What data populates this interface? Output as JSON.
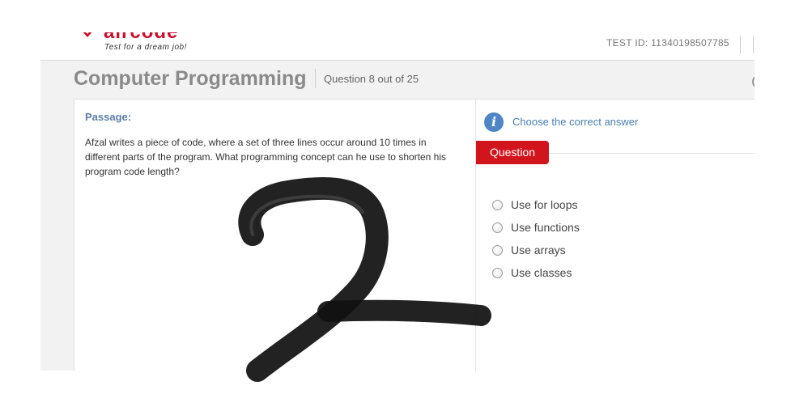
{
  "header": {
    "logo_text": "aircode",
    "tagline": "Test for a dream job!",
    "test_id": "TEST ID: 11340198507785"
  },
  "page": {
    "title": "Computer Programming",
    "question_counter": "Question 8 out of 25"
  },
  "passage": {
    "label": "Passage:",
    "text": "Afzal writes a piece of code, where a set of three lines occur around 10 times in different parts of the program. What programming concept can he use to shorten his program code length?"
  },
  "question_panel": {
    "instruction": "Choose the correct answer",
    "tab_label": "Question",
    "options": [
      "Use for loops",
      "Use functions",
      "Use arrays",
      "Use classes"
    ]
  },
  "colors": {
    "brand_red": "#d2151d",
    "link_blue": "#4a7fb1",
    "passage_blue": "#5a7fa6",
    "scribble": "#111111"
  },
  "icons": [
    "info-icon",
    "radio-icon"
  ]
}
